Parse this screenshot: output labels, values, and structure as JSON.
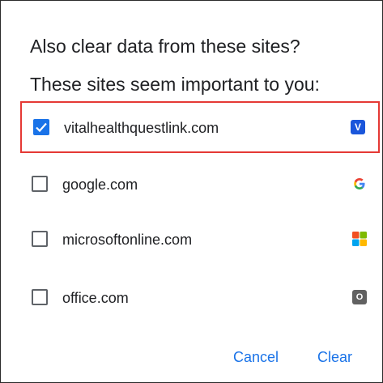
{
  "dialog": {
    "title": "Also clear data from these sites?",
    "subtitle": "These sites seem important to you:",
    "sites": [
      {
        "domain": "vitalhealthquestlink.com",
        "checked": true,
        "favicon": "v-letter-icon",
        "favicon_text": "V"
      },
      {
        "domain": "google.com",
        "checked": false,
        "favicon": "google-g-icon",
        "favicon_text": "G"
      },
      {
        "domain": "microsoftonline.com",
        "checked": false,
        "favicon": "microsoft-logo-icon"
      },
      {
        "domain": "office.com",
        "checked": false,
        "favicon": "o-letter-icon",
        "favicon_text": "O"
      }
    ],
    "cancel_label": "Cancel",
    "clear_label": "Clear"
  },
  "colors": {
    "accent": "#1a73e8",
    "highlight_border": "#e53935",
    "text": "#202124"
  }
}
